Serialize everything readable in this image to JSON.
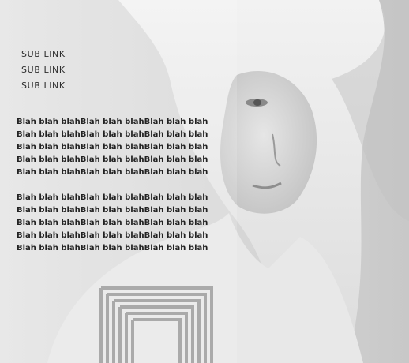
{
  "nav": {
    "items": [
      {
        "label": "SUB LINK"
      },
      {
        "label": "SUB LINK"
      },
      {
        "label": "SUB LINK"
      }
    ]
  },
  "content": {
    "paragraphs": [
      {
        "lines": [
          "Blah blah blahBlah blah blahBlah blah blah",
          "Blah blah blahBlah blah blahBlah blah blah",
          "Blah blah blahBlah blah blahBlah blah blah",
          "Blah blah blahBlah blah blahBlah blah blah",
          "Blah blah blahBlah blah blahBlah blah blah"
        ]
      },
      {
        "lines": [
          "Blah blah blahBlah blah blahBlah blah blah",
          "Blah blah blahBlah blah blahBlah blah blah",
          "Blah blah blahBlah blah blahBlah blah blah",
          "Blah blah blahBlah blah blahBlah blah blah",
          "Blah blah blahBlah blah blahBlah blah blah"
        ]
      }
    ]
  },
  "colors": {
    "background": "#d8d8d8",
    "text": "#222222",
    "link": "#2e2e2e"
  }
}
